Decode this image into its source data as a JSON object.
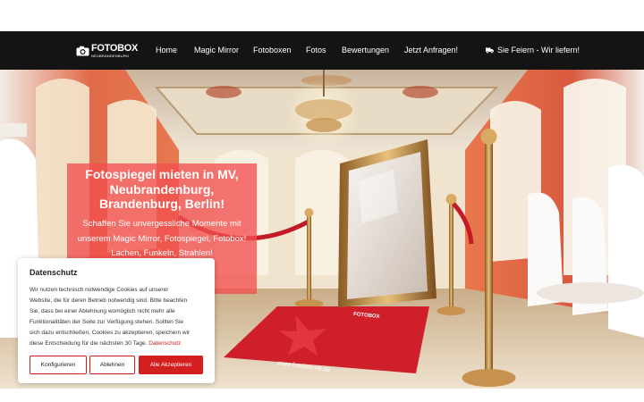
{
  "logo": {
    "name": "FOTOBOX",
    "sub": "NEUBRANDENBURG"
  },
  "nav": {
    "items": [
      {
        "label": "Home"
      },
      {
        "label": "Magic Mirror"
      },
      {
        "label": "Fotoboxen"
      },
      {
        "label": "Fotos"
      },
      {
        "label": "Bewertungen"
      },
      {
        "label": "Jetzt Anfragen!"
      }
    ],
    "cta": {
      "label": "Sie Feiern - Wir liefern!",
      "icon": "truck-icon"
    }
  },
  "hero": {
    "title_lines": [
      "Fotospiegel mieten in MV,",
      "Neubrandenburg,",
      "Brandenburg, Berlin!"
    ],
    "subtitle_lines": [
      "Schaffen Sie unvergessliche Momente mit",
      "unserem Magic Mirror, Fotospiegel, Fotobox!",
      "Lachen, Funkeln, Strahlen!"
    ],
    "carpet_brand": "FOTOBOX",
    "carpet_url": "www.fotobox-nb.de",
    "accent_color": "#f25050"
  },
  "cookie": {
    "title": "Datenschutz",
    "text_lines": [
      "Wir nutzen technisch notwendige Cookies auf unserer",
      "Website, die für deren Betrieb notwendig sind. Bitte beachten",
      "Sie, dass bei einer Ablehnung womöglich nicht mehr alle",
      "Funktionalitäten der Seite zur Verfügung stehen. Sollten Sie",
      "sich dazu entschließen, Cookies zu akzeptieren, speichern wir",
      "diese Entscheidung für die nächsten 30 Tage."
    ],
    "link": "Datenschutz",
    "buttons": {
      "configure": "Konfigurieren",
      "reject": "Ablehnen",
      "accept": "Alle Akzeptieren"
    },
    "button_color": "#d31f1f"
  }
}
